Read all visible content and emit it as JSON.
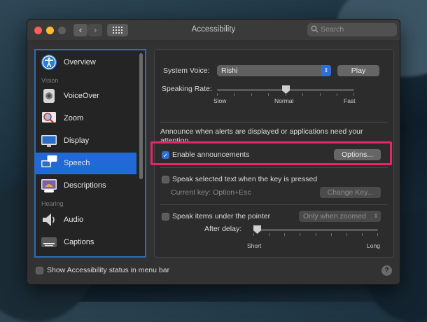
{
  "window": {
    "title": "Accessibility"
  },
  "toolbar": {
    "back_glyph": "‹",
    "forward_glyph": "›",
    "grid_icon": "grid-icon"
  },
  "search": {
    "placeholder": "Search"
  },
  "colors": {
    "accent": "#2f6fd6",
    "selection": "#2069d6",
    "highlight": "#e8246b"
  },
  "sidebar": {
    "categories": {
      "vision": "Vision",
      "hearing": "Hearing"
    },
    "items": [
      {
        "label": "Overview",
        "icon": "accessibility-icon"
      },
      {
        "label": "VoiceOver",
        "icon": "voiceover-icon"
      },
      {
        "label": "Zoom",
        "icon": "zoom-icon"
      },
      {
        "label": "Display",
        "icon": "display-icon"
      },
      {
        "label": "Speech",
        "icon": "speech-icon",
        "selected": true
      },
      {
        "label": "Descriptions",
        "icon": "descriptions-icon"
      },
      {
        "label": "Audio",
        "icon": "speaker-icon"
      },
      {
        "label": "Captions",
        "icon": "captions-icon"
      }
    ]
  },
  "speech": {
    "system_voice_label": "System Voice:",
    "system_voice_value": "Rishi",
    "play_label": "Play",
    "speaking_rate_label": "Speaking Rate:",
    "rate_slow": "Slow",
    "rate_normal": "Normal",
    "rate_fast": "Fast",
    "speaking_rate_level": 0.5,
    "announce_text": "Announce when alerts are displayed or applications need your attention.",
    "enable_announcements_label": "Enable announcements",
    "enable_announcements_checked": true,
    "options_label": "Options...",
    "speak_selected_label": "Speak selected text when the key is pressed",
    "speak_selected_checked": false,
    "current_key_label": "Current key: Option+Esc",
    "change_key_label": "Change Key...",
    "speak_pointer_label": "Speak items under the pointer",
    "speak_pointer_checked": false,
    "pointer_mode_value": "Only when zoomed",
    "after_delay_label": "After delay:",
    "delay_short": "Short",
    "delay_long": "Long",
    "delay_level": 0.0
  },
  "footer": {
    "show_status_label": "Show Accessibility status in menu bar",
    "show_status_checked": false,
    "help_label": "?"
  }
}
